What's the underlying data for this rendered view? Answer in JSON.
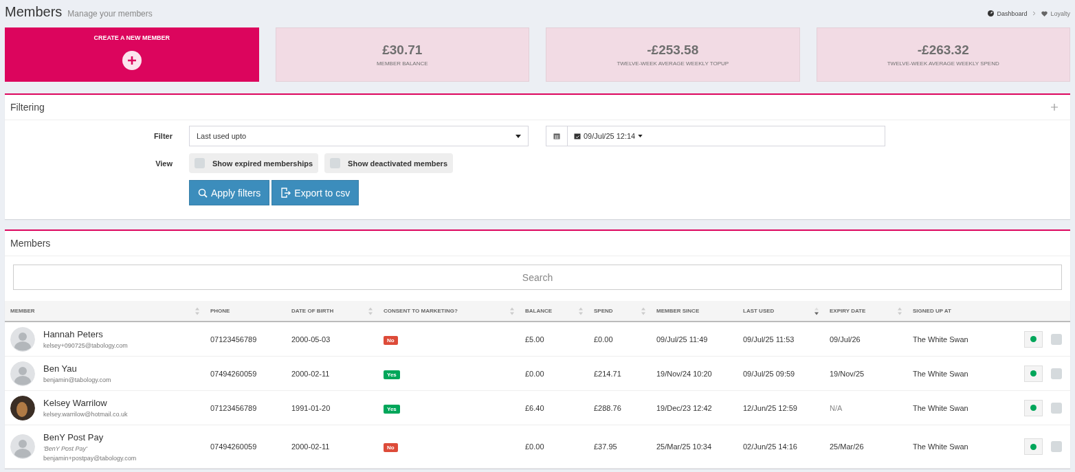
{
  "header": {
    "title": "Members",
    "subtitle": "Manage your members",
    "breadcrumbs": [
      {
        "label": "Dashboard"
      },
      {
        "label": "Loyalty"
      }
    ]
  },
  "create_card": {
    "label": "CREATE A NEW MEMBER"
  },
  "stats": [
    {
      "value": "£30.71",
      "label": "MEMBER BALANCE"
    },
    {
      "value": "-£253.58",
      "label": "TWELVE-WEEK AVERAGE WEEKLY TOPUP"
    },
    {
      "value": "-£263.32",
      "label": "TWELVE-WEEK AVERAGE WEEKLY SPEND"
    }
  ],
  "filtering": {
    "title": "Filtering",
    "filter_label": "Filter",
    "filter_value": "Last used upto",
    "date_value": "09/Jul/25 12:14",
    "view_label": "View",
    "toggles": [
      {
        "label": "Show expired memberships",
        "checked": false
      },
      {
        "label": "Show deactivated members",
        "checked": false
      }
    ],
    "buttons": [
      {
        "label": "Apply filters"
      },
      {
        "label": "Export to csv"
      }
    ]
  },
  "members": {
    "title": "Members",
    "search_placeholder": "Search",
    "columns": [
      {
        "label": "MEMBER",
        "kind": "sortable"
      },
      {
        "label": "PHONE",
        "kind": "plain"
      },
      {
        "label": "DATE OF BIRTH",
        "kind": "sortable"
      },
      {
        "label": "CONSENT TO MARKETING?",
        "kind": "sortable"
      },
      {
        "label": "BALANCE",
        "kind": "sortable"
      },
      {
        "label": "SPEND",
        "kind": "sortable"
      },
      {
        "label": "MEMBER SINCE",
        "kind": "plain"
      },
      {
        "label": "LAST USED",
        "kind": "sorted"
      },
      {
        "label": "EXPIRY DATE",
        "kind": "sortable"
      },
      {
        "label": "SIGNED UP AT",
        "kind": "plain"
      }
    ],
    "rows": [
      {
        "name": "Hannah Peters",
        "email": "kelsey+090725@tabology.com",
        "kind": "placeholder",
        "phone": "07123456789",
        "dob": "2000-05-03",
        "consent": "No",
        "consent_given": false,
        "balance": "£5.00",
        "spend": "£0.00",
        "member_since": "09/Jul/25 11:49",
        "last_used": "09/Jul/25 11:53",
        "expiry": "09/Jul/26",
        "expiry_muted": false,
        "signed_up_at": "The White Swan",
        "active": true,
        "checked": false
      },
      {
        "name": "Ben Yau",
        "email": "benjamin@tabology.com",
        "kind": "placeholder",
        "phone": "07494260059",
        "dob": "2000-02-11",
        "consent": "Yes",
        "consent_given": true,
        "balance": "£0.00",
        "spend": "£214.71",
        "member_since": "19/Nov/24 10:20",
        "last_used": "09/Jul/25 09:59",
        "expiry": "19/Nov/25",
        "expiry_muted": false,
        "signed_up_at": "The White Swan",
        "active": true,
        "checked": false
      },
      {
        "name": "Kelsey Warrilow",
        "email": "kelsey.warrilow@hotmail.co.uk",
        "kind": "photo",
        "phone": "07123456789",
        "dob": "1991-01-20",
        "consent": "Yes",
        "consent_given": true,
        "balance": "£6.40",
        "spend": "£288.76",
        "member_since": "19/Dec/23 12:42",
        "last_used": "12/Jun/25 12:59",
        "expiry": "N/A",
        "expiry_muted": true,
        "signed_up_at": "The White Swan",
        "active": true,
        "checked": false
      },
      {
        "name": "BenY Post Pay",
        "nickname": "'BenY Post Pay'",
        "email": "benjamin+postpay@tabology.com",
        "kind": "placeholder",
        "phone": "07494260059",
        "dob": "2000-02-11",
        "consent": "No",
        "consent_given": false,
        "balance": "£0.00",
        "spend": "£37.95",
        "member_since": "25/Mar/25 10:34",
        "last_used": "02/Jun/25 14:16",
        "expiry": "25/Mar/26",
        "expiry_muted": false,
        "signed_up_at": "The White Swan",
        "active": true,
        "checked": false
      }
    ]
  }
}
